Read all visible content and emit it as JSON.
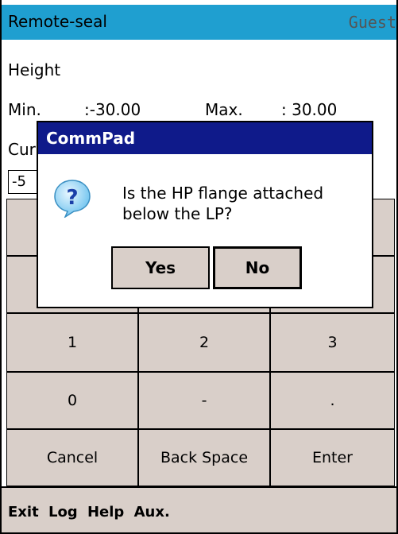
{
  "titlebar": {
    "app_name": "Remote-seal",
    "user": "Guest"
  },
  "fields": {
    "height_label": "Height",
    "min_label": "Min.",
    "min_value": ":-30.00",
    "max_label": "Max.",
    "max_value": ": 30.00",
    "current_label_partial": "Cur",
    "current_value_partial": "-5"
  },
  "keypad": {
    "keys": [
      "1",
      "2",
      "3",
      "0",
      "-",
      ".",
      "Cancel",
      "Back Space",
      "Enter"
    ]
  },
  "dialog": {
    "title": "CommPad",
    "message": "Is the HP flange attached below the LP?",
    "yes_label": "Yes",
    "no_label": "No",
    "icon": "question-icon"
  },
  "menu": {
    "items": [
      "Exit",
      "Log",
      "Help",
      "Aux."
    ]
  },
  "colors": {
    "titlebar_bg": "#1f9fd0",
    "key_bg": "#d9cfc9",
    "dialog_title_bg": "#0f1a8a"
  }
}
